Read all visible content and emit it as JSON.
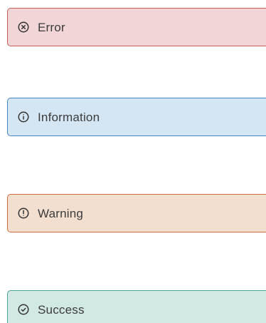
{
  "alerts": [
    {
      "type": "error",
      "label": "Error",
      "icon": "x-circle-icon",
      "color": "#c95b5b"
    },
    {
      "type": "info",
      "label": "Information",
      "icon": "info-circle-icon",
      "color": "#4a86c5"
    },
    {
      "type": "warning",
      "label": "Warning",
      "icon": "exclamation-circle-icon",
      "color": "#d06a3f"
    },
    {
      "type": "success",
      "label": "Success",
      "icon": "check-circle-icon",
      "color": "#4aa59a"
    }
  ]
}
